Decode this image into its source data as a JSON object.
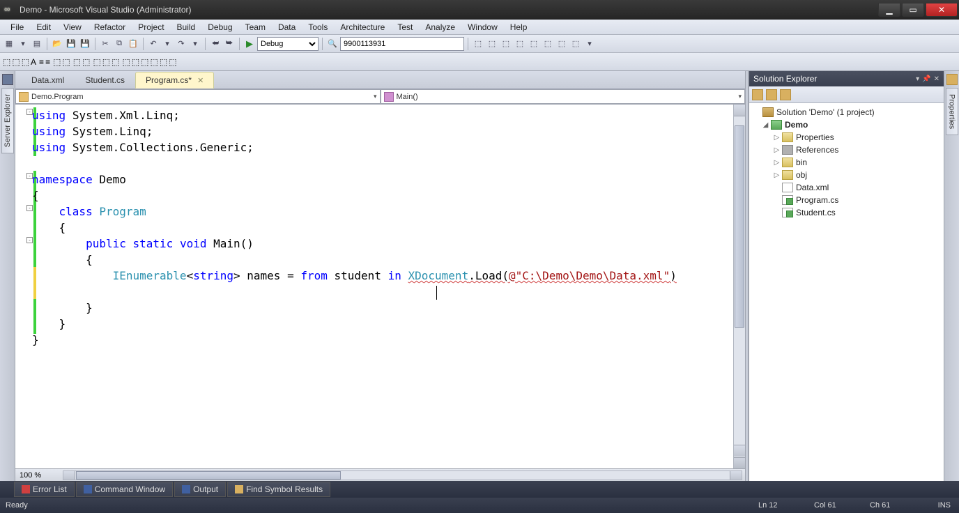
{
  "title": "Demo - Microsoft Visual Studio (Administrator)",
  "menu": [
    "File",
    "Edit",
    "View",
    "Refactor",
    "Project",
    "Build",
    "Debug",
    "Team",
    "Data",
    "Tools",
    "Architecture",
    "Test",
    "Analyze",
    "Window",
    "Help"
  ],
  "toolbar": {
    "config": "Debug",
    "search": "9900113931"
  },
  "tabs": [
    {
      "label": "Data.xml",
      "active": false
    },
    {
      "label": "Student.cs",
      "active": false
    },
    {
      "label": "Program.cs*",
      "active": true
    }
  ],
  "nav": {
    "type": "Demo.Program",
    "member": "Main()"
  },
  "zoom": "100 %",
  "code": {
    "using1": "using",
    "using2": "using",
    "using3": "using",
    "ns1": "System.Xml.Linq;",
    "ns2": "System.Linq;",
    "ns3": "System.Collections.Generic;",
    "namespace_kw": "namespace",
    "namespace_name": "Demo",
    "class_kw": "class",
    "class_name": "Program",
    "public_kw": "public",
    "static_kw": "static",
    "void_kw": "void",
    "main": "Main()",
    "ienum": "IEnumerable",
    "string_kw": "string",
    "names": "names =",
    "from_kw": "from",
    "student": "student",
    "in_kw": "in",
    "xdoc": "XDocument",
    "load": ".Load(",
    "at": "@",
    "path": "\"C:\\Demo\\Demo\\Data.xml\"",
    "rp": ")"
  },
  "solution": {
    "title": "Solution Explorer",
    "root": "Solution 'Demo' (1 project)",
    "project": "Demo",
    "items": [
      "Properties",
      "References",
      "bin",
      "obj",
      "Data.xml",
      "Program.cs",
      "Student.cs"
    ]
  },
  "leftbar": "Server Explorer",
  "rightbar_label": "Properties",
  "bottom": [
    "Error List",
    "Command Window",
    "Output",
    "Find Symbol Results"
  ],
  "status": {
    "ready": "Ready",
    "ln": "Ln 12",
    "col": "Col 61",
    "ch": "Ch 61",
    "ins": "INS"
  }
}
